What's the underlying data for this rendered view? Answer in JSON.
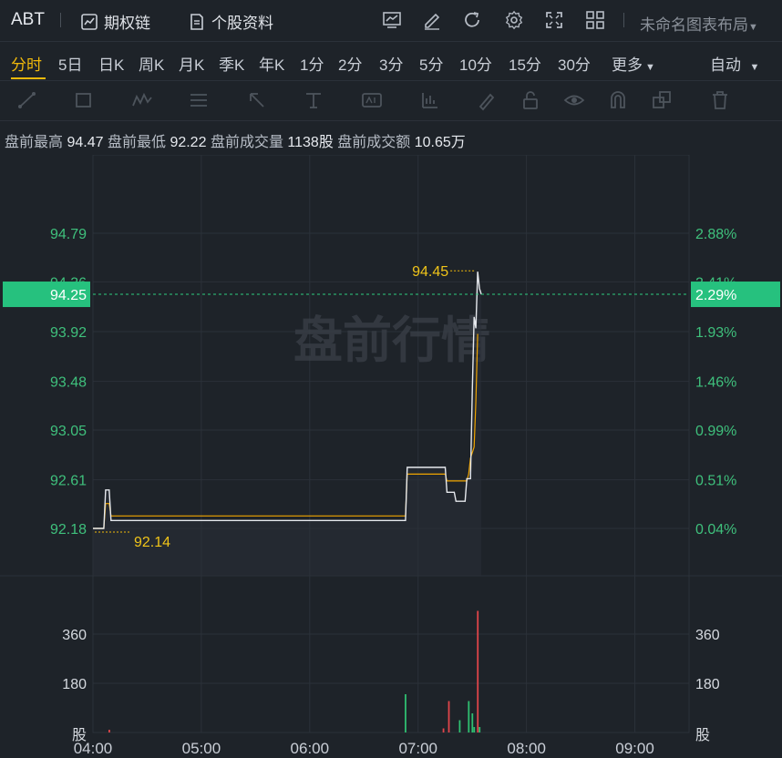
{
  "topbar": {
    "symbol": "ABT",
    "options_chain": "期权链",
    "stock_profile": "个股资料",
    "layout_name": "未命名图表布局"
  },
  "periods": {
    "items": [
      "分时",
      "5日",
      "日K",
      "周K",
      "月K",
      "季K",
      "年K",
      "1分",
      "2分",
      "3分",
      "5分",
      "10分",
      "15分",
      "30分",
      "更多"
    ],
    "active": "分时",
    "auto_label": "自动"
  },
  "info": {
    "high_label": "盘前最高",
    "high": "94.47",
    "low_label": "盘前最低",
    "low": "92.22",
    "vol_label": "盘前成交量",
    "vol": "1138股",
    "amt_label": "盘前成交额",
    "amt": "10.65万"
  },
  "chart_data": {
    "type": "line",
    "watermark": "盘前行情",
    "x_ticks": [
      "04:00",
      "05:00",
      "06:00",
      "07:00",
      "08:00",
      "09:00"
    ],
    "price_ticks": [
      "94.79",
      "94.36",
      "93.92",
      "93.48",
      "93.05",
      "92.61",
      "92.18"
    ],
    "pct_ticks": [
      "2.88%",
      "2.41%",
      "1.93%",
      "1.46%",
      "0.99%",
      "0.51%",
      "0.04%"
    ],
    "price_ylim": [
      92.18,
      94.79
    ],
    "current_price": "94.25",
    "current_pct": "2.29%",
    "max_marker": "94.45",
    "min_marker": "92.14",
    "volume_ticks": [
      "360",
      "180"
    ],
    "volume_unit": "股",
    "series": [
      {
        "name": "price",
        "color": "#e6e9ee",
        "points": [
          [
            "04:00",
            92.18
          ],
          [
            "04:06",
            92.18
          ],
          [
            "04:07",
            92.52
          ],
          [
            "04:09",
            92.52
          ],
          [
            "04:10",
            92.25
          ],
          [
            "06:53",
            92.25
          ],
          [
            "06:54",
            92.72
          ],
          [
            "07:15",
            92.72
          ],
          [
            "07:16",
            92.5
          ],
          [
            "07:20",
            92.5
          ],
          [
            "07:21",
            92.42
          ],
          [
            "07:26",
            92.42
          ],
          [
            "07:27",
            92.62
          ],
          [
            "07:29",
            92.62
          ],
          [
            "07:30",
            93.4
          ],
          [
            "07:31",
            94.05
          ],
          [
            "07:32",
            93.95
          ],
          [
            "07:33",
            94.45
          ],
          [
            "07:34",
            94.3
          ],
          [
            "07:35",
            94.25
          ]
        ]
      },
      {
        "name": "avg",
        "color": "#f0a500",
        "points": [
          [
            "04:00",
            92.18
          ],
          [
            "04:06",
            92.18
          ],
          [
            "04:07",
            92.4
          ],
          [
            "04:09",
            92.4
          ],
          [
            "04:10",
            92.29
          ],
          [
            "06:53",
            92.29
          ],
          [
            "06:54",
            92.66
          ],
          [
            "07:15",
            92.66
          ],
          [
            "07:16",
            92.6
          ],
          [
            "07:27",
            92.6
          ],
          [
            "07:28",
            92.66
          ],
          [
            "07:29",
            92.8
          ],
          [
            "07:31",
            92.9
          ],
          [
            "07:32",
            93.3
          ],
          [
            "07:33",
            93.9
          ]
        ]
      }
    ],
    "volume_bars": [
      {
        "t": "04:09",
        "v": 10,
        "color": "#e0454a"
      },
      {
        "t": "06:53",
        "v": 140,
        "color": "#2fbf71"
      },
      {
        "t": "07:14",
        "v": 15,
        "color": "#e0454a"
      },
      {
        "t": "07:17",
        "v": 115,
        "color": "#e0454a"
      },
      {
        "t": "07:23",
        "v": 45,
        "color": "#2fbf71"
      },
      {
        "t": "07:28",
        "v": 115,
        "color": "#2fbf71"
      },
      {
        "t": "07:30",
        "v": 70,
        "color": "#2fbf71"
      },
      {
        "t": "07:31",
        "v": 20,
        "color": "#2fbf71"
      },
      {
        "t": "07:33",
        "v": 445,
        "color": "#e0454a"
      },
      {
        "t": "07:34",
        "v": 20,
        "color": "#2fbf71"
      }
    ]
  }
}
